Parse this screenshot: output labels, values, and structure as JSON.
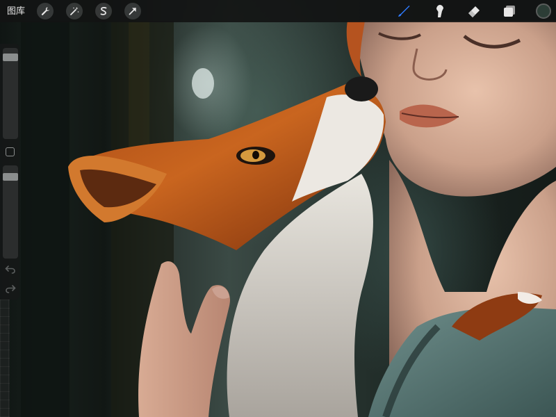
{
  "toolbar": {
    "gallery_label": "图库",
    "left_tools": [
      {
        "name": "actions",
        "icon": "wrench-icon"
      },
      {
        "name": "adjustments",
        "icon": "magic-wand-icon"
      },
      {
        "name": "selection",
        "icon": "selection-s-icon"
      },
      {
        "name": "transform",
        "icon": "arrow-cursor-icon"
      }
    ],
    "right_tools": [
      {
        "name": "brush",
        "icon": "brush-icon",
        "active": true
      },
      {
        "name": "smudge",
        "icon": "smudge-icon"
      },
      {
        "name": "eraser",
        "icon": "eraser-icon"
      },
      {
        "name": "layers",
        "icon": "layers-icon"
      }
    ],
    "current_color": "#2c3d36",
    "active_color": "#2f7bff"
  },
  "sidebar": {
    "brush_size": 0.93,
    "opacity": 0.91,
    "modify_icon": "square-icon",
    "undo_icon": "undo-arrow-icon",
    "redo_icon": "redo-arrow-icon"
  },
  "canvas": {
    "subject": "painting"
  }
}
